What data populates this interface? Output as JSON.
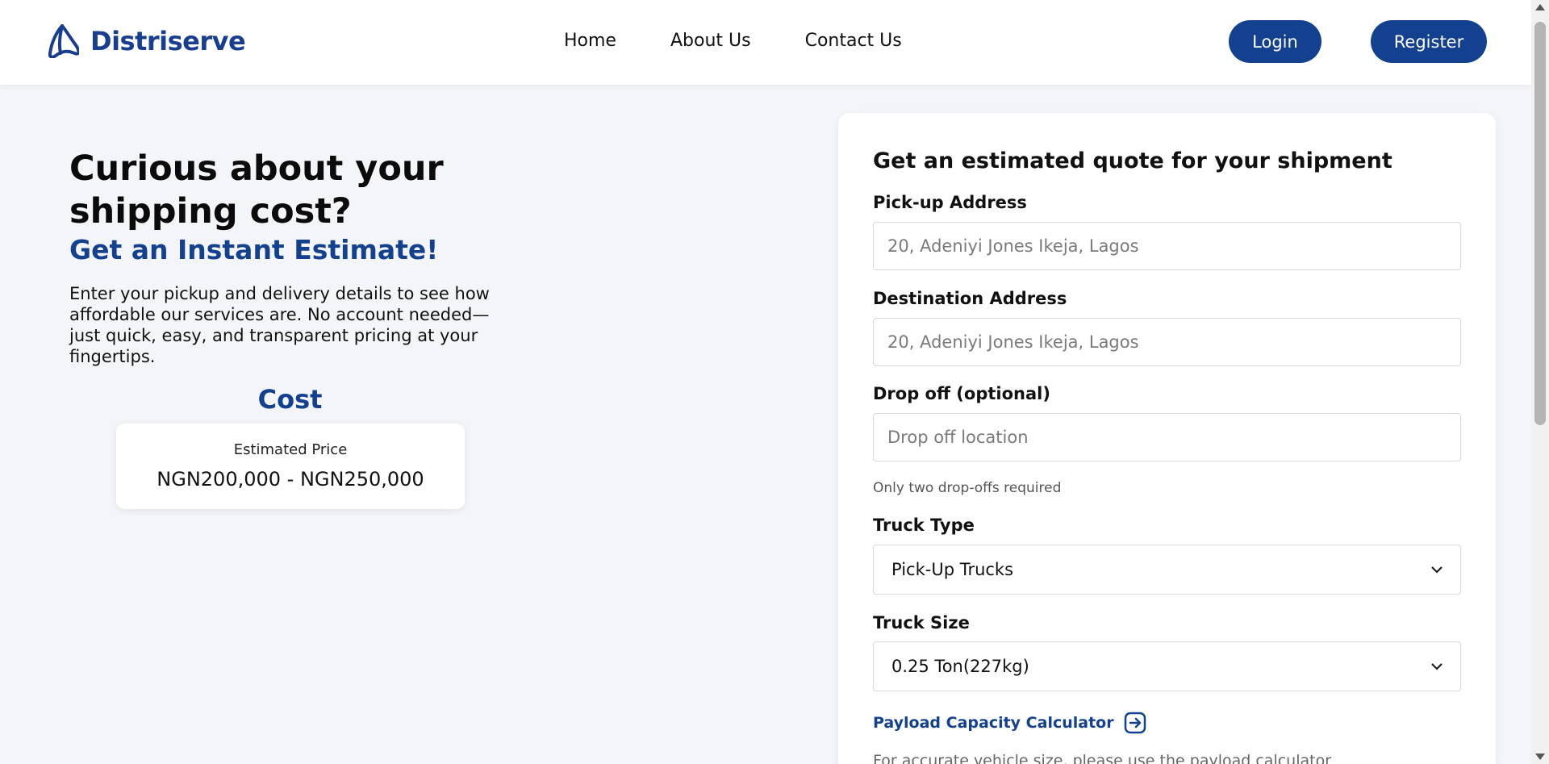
{
  "brand": {
    "name": "Distriserve",
    "color": "#13418f"
  },
  "nav": {
    "items": [
      "Home",
      "About Us",
      "Contact Us"
    ]
  },
  "auth": {
    "login_label": "Login",
    "register_label": "Register"
  },
  "hero": {
    "title": "Curious about your shipping cost?",
    "subtitle": "Get an Instant Estimate!",
    "description": "Enter your pickup and delivery details to see how affordable our services are. No account needed—just quick, easy, and transparent pricing at your fingertips."
  },
  "cost": {
    "title": "Cost",
    "label": "Estimated Price",
    "value": "NGN200,000 - NGN250,000"
  },
  "form": {
    "title": "Get an estimated quote for your shipment",
    "pickup": {
      "label": "Pick-up Address",
      "placeholder": "20, Adeniyi Jones Ikeja, Lagos",
      "value": ""
    },
    "destination": {
      "label": "Destination Address",
      "placeholder": "20, Adeniyi Jones Ikeja, Lagos",
      "value": ""
    },
    "dropoff": {
      "label": "Drop off (optional)",
      "placeholder": "Drop off location",
      "value": "",
      "hint": "Only two drop-offs required"
    },
    "truck_type": {
      "label": "Truck Type",
      "selected": "Pick-Up Trucks"
    },
    "truck_size": {
      "label": "Truck Size",
      "selected": "0.25 Ton(227kg)"
    },
    "calculator": {
      "label": "Payload Capacity Calculator",
      "icon": "arrow-right-square-icon"
    },
    "calc_note": "For accurate vehicle size, please use the payload calculator"
  },
  "icons": {
    "logo": "distriserve-logo-icon",
    "select_chevron": "chevron-down-icon"
  }
}
